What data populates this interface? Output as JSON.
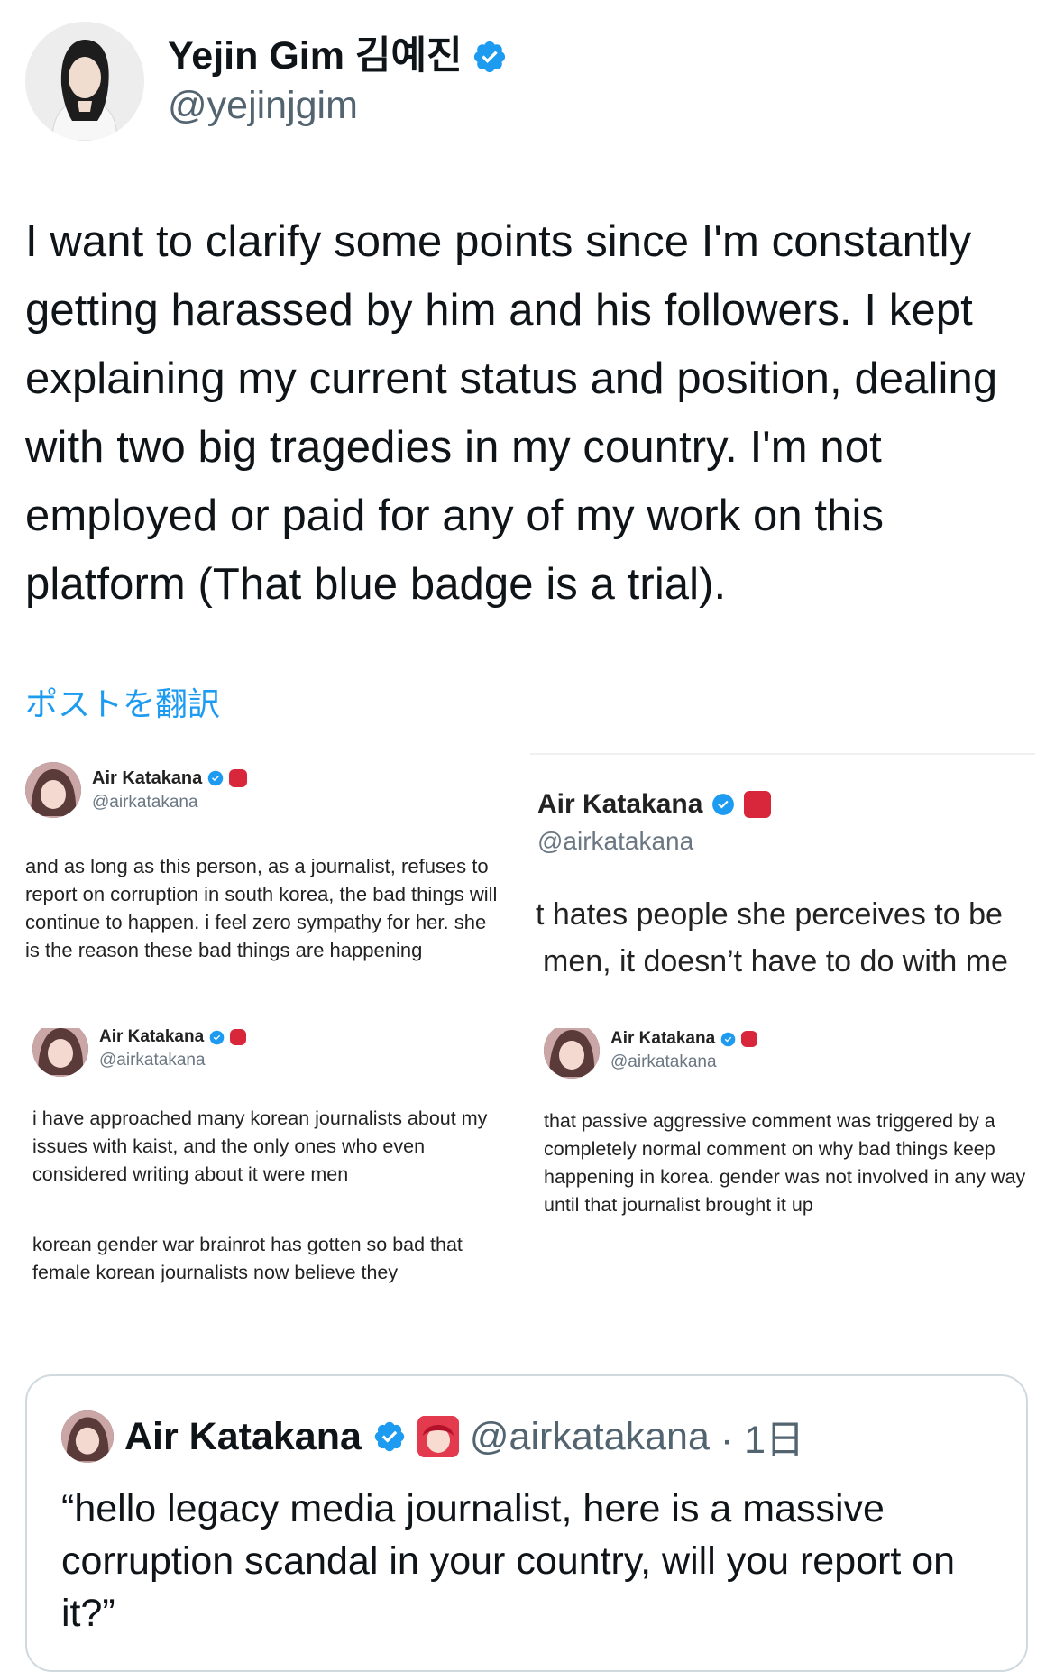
{
  "author": {
    "display_name": "Yejin Gim 김예진",
    "handle": "@yejinjgim"
  },
  "post": {
    "text": "I want to clarify some points since I'm constantly getting harassed by him and his followers. I kept explaining my current status and position, dealing with two big tragedies in my country. I'm not employed or paid for any of my work on this platform (That blue badge is a trial).",
    "translate_label": "ポストを翻訳"
  },
  "embedded_screenshots": {
    "shot1": {
      "name": "Air Katakana",
      "handle": "@airkatakana",
      "text": "and as long as this person, as a journalist, refuses to report on corruption in south korea, the bad things will continue to happen. i feel zero sympathy for her. she is the reason these bad things are happening"
    },
    "shot2": {
      "name": "Air Katakana",
      "handle": "@airkatakana",
      "line1": "t hates people she perceives to be",
      "line2": "men, it doesn’t have to do with me"
    },
    "shot3": {
      "name": "Air Katakana",
      "handle": "@airkatakana",
      "para1": "i have approached many korean journalists about my issues with kaist, and the only ones who even considered writing about it were men",
      "para2": "korean gender war brainrot has gotten so bad that female korean journalists now believe they"
    },
    "shot4": {
      "name": "Air Katakana",
      "handle": "@airkatakana",
      "text": "that passive aggressive comment was triggered by a completely normal comment on why bad things keep happening in korea. gender was not involved in any way until that journalist brought it up"
    }
  },
  "quoted_post": {
    "name": "Air Katakana",
    "handle": "@airkatakana",
    "time": "· 1日",
    "text": "“hello legacy media journalist, here is a massive corruption scandal in your country, will you report on it?”"
  },
  "colors": {
    "link_blue": "#1d9bf0",
    "verified_blue": "#1d9bf0",
    "text": "#0f1419",
    "secondary": "#536471",
    "border": "#cfd9de"
  }
}
